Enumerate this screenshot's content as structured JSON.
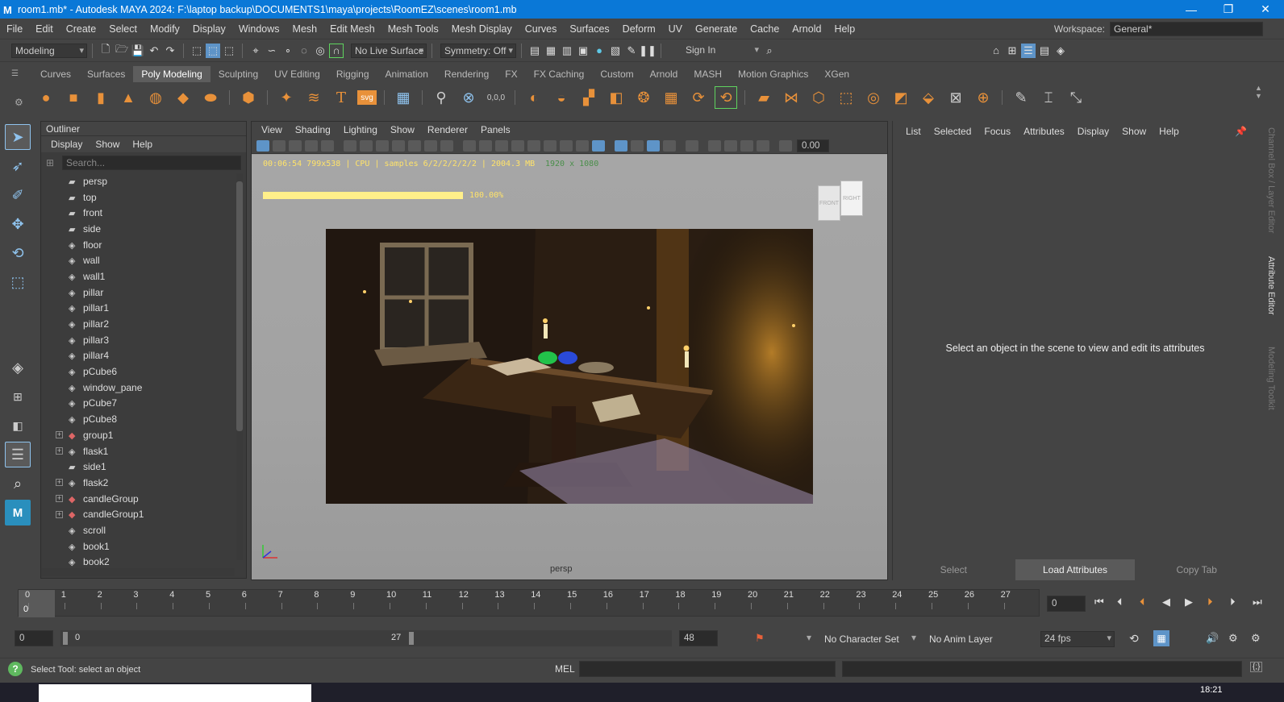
{
  "window": {
    "title": "room1.mb* - Autodesk MAYA 2024: F:\\laptop backup\\DOCUMENTS1\\maya\\projects\\RoomEZ\\scenes\\room1.mb",
    "minimize": "—",
    "maximize": "❐",
    "close": "✕"
  },
  "menubar": {
    "items": [
      "File",
      "Edit",
      "Create",
      "Select",
      "Modify",
      "Display",
      "Windows",
      "Mesh",
      "Edit Mesh",
      "Mesh Tools",
      "Mesh Display",
      "Curves",
      "Surfaces",
      "Deform",
      "UV",
      "Generate",
      "Cache",
      "Arnold",
      "Help"
    ],
    "workspace_label": "Workspace:",
    "workspace_value": "General*"
  },
  "statusline": {
    "mode": "Modeling",
    "live_surface": "No Live Surface",
    "symmetry": "Symmetry: Off",
    "sign_in": "Sign In"
  },
  "shelf": {
    "tabs": [
      "Curves",
      "Surfaces",
      "Poly Modeling",
      "Sculpting",
      "UV Editing",
      "Rigging",
      "Animation",
      "Rendering",
      "FX",
      "FX Caching",
      "Custom",
      "Arnold",
      "MASH",
      "Motion Graphics",
      "XGen"
    ],
    "active_tab": "Poly Modeling",
    "text_tool": "T",
    "svg_tool": "svg"
  },
  "outliner": {
    "title": "Outliner",
    "menu": [
      "Display",
      "Show",
      "Help"
    ],
    "search_placeholder": "Search...",
    "items": [
      {
        "name": "persp",
        "type": "camera",
        "expandable": false
      },
      {
        "name": "top",
        "type": "camera",
        "expandable": false
      },
      {
        "name": "front",
        "type": "camera",
        "expandable": false
      },
      {
        "name": "side",
        "type": "camera",
        "expandable": false
      },
      {
        "name": "floor",
        "type": "mesh",
        "expandable": false
      },
      {
        "name": "wall",
        "type": "mesh",
        "expandable": false
      },
      {
        "name": "wall1",
        "type": "mesh",
        "expandable": false
      },
      {
        "name": "pillar",
        "type": "mesh",
        "expandable": false
      },
      {
        "name": "pillar1",
        "type": "mesh",
        "expandable": false
      },
      {
        "name": "pillar2",
        "type": "mesh",
        "expandable": false
      },
      {
        "name": "pillar3",
        "type": "mesh",
        "expandable": false
      },
      {
        "name": "pillar4",
        "type": "mesh",
        "expandable": false
      },
      {
        "name": "pCube6",
        "type": "mesh",
        "expandable": false
      },
      {
        "name": "window_pane",
        "type": "mesh",
        "expandable": false
      },
      {
        "name": "pCube7",
        "type": "mesh",
        "expandable": false
      },
      {
        "name": "pCube8",
        "type": "mesh",
        "expandable": false
      },
      {
        "name": "group1",
        "type": "group",
        "expandable": true
      },
      {
        "name": "flask1",
        "type": "mesh",
        "expandable": true
      },
      {
        "name": "side1",
        "type": "camera",
        "expandable": false
      },
      {
        "name": "flask2",
        "type": "mesh",
        "expandable": true
      },
      {
        "name": "candleGroup",
        "type": "group",
        "expandable": true
      },
      {
        "name": "candleGroup1",
        "type": "group",
        "expandable": true
      },
      {
        "name": "scroll",
        "type": "mesh",
        "expandable": false
      },
      {
        "name": "book1",
        "type": "mesh",
        "expandable": false
      },
      {
        "name": "book2",
        "type": "mesh",
        "expandable": false
      }
    ]
  },
  "viewport": {
    "menu": [
      "View",
      "Shading",
      "Lighting",
      "Show",
      "Renderer",
      "Panels"
    ],
    "field_value": "0.00",
    "hud_stats": "00:06:54 799x538 | CPU | samples 6/2/2/2/2/2 | 2004.3 MB",
    "hud_resolution": "1920 x 1080",
    "progress_percent": 100,
    "progress_text": "100.00%",
    "camera_label": "persp",
    "viewcube_front": "FRONT",
    "viewcube_right": "RIGHT"
  },
  "attribute_editor": {
    "menu": [
      "List",
      "Selected",
      "Focus",
      "Attributes",
      "Display",
      "Show",
      "Help"
    ],
    "message": "Select an object in the scene to view and edit its attributes",
    "buttons": [
      "Select",
      "Load Attributes",
      "Copy Tab"
    ]
  },
  "side_tabs": [
    "Channel Box / Layer Editor",
    "Attribute Editor",
    "Modeling Toolkit"
  ],
  "timeline": {
    "ticks": [
      "0",
      "1",
      "2",
      "3",
      "4",
      "5",
      "6",
      "7",
      "8",
      "9",
      "10",
      "11",
      "12",
      "13",
      "14",
      "15",
      "16",
      "17",
      "18",
      "19",
      "20",
      "21",
      "22",
      "23",
      "24",
      "25",
      "26",
      "27"
    ],
    "current_frame_marker": "0",
    "current_frame_field": "0"
  },
  "range": {
    "start": "0",
    "inner_start": "0",
    "inner_end": "27",
    "end": "48",
    "character_set": "No Character Set",
    "anim_layer": "No Anim Layer",
    "fps": "24 fps"
  },
  "command": {
    "help_text": "Select Tool: select an object",
    "mel_label": "MEL"
  },
  "taskbar": {
    "clock": "18:21"
  }
}
